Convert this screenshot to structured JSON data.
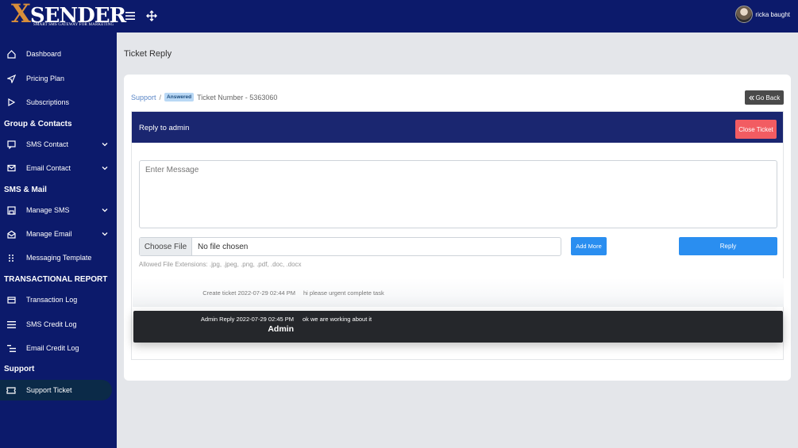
{
  "brand": {
    "logo_text": "SENDER",
    "logo_x": "X",
    "tagline": "SMART SMS GATEWAY FOR MARKETING"
  },
  "topbar": {
    "menu_icon": "hamburger-icon",
    "move_icon": "move-arrows-icon",
    "user_name": "ricka baught"
  },
  "sidebar": {
    "items": [
      {
        "label": "Dashboard",
        "icon": "home-icon"
      },
      {
        "label": "Pricing Plan",
        "icon": "send-icon"
      },
      {
        "label": "Subscriptions",
        "icon": "play-icon"
      },
      {
        "label": "SMS Contact",
        "icon": "message-icon"
      },
      {
        "label": "Email Contact",
        "icon": "mail-icon"
      },
      {
        "label": "Manage SMS",
        "icon": "save-icon"
      },
      {
        "label": "Manage Email",
        "icon": "mail-open-icon"
      },
      {
        "label": "Messaging Template",
        "icon": "grip-icon"
      },
      {
        "label": "Transaction Log",
        "icon": "card-icon"
      },
      {
        "label": "SMS Credit Log",
        "icon": "list-icon"
      },
      {
        "label": "Email Credit Log",
        "icon": "list-indent-icon"
      },
      {
        "label": "Support Ticket",
        "icon": "ticket-icon"
      }
    ],
    "headings": [
      "Group & Contacts",
      "SMS & Mail",
      "TRANSACTIONAL REPORT",
      "Support"
    ]
  },
  "page": {
    "title": "Ticket Reply"
  },
  "breadcrumb": {
    "link": "Support",
    "separator": "/",
    "badge": "Answered",
    "current": "Ticket Number - 5363060"
  },
  "buttons": {
    "go_back": "Go Back",
    "close_ticket": "Close Ticket",
    "add_more": "Add More",
    "reply": "Reply",
    "choose_file": "Choose File"
  },
  "reply_panel": {
    "title": "Reply to admin",
    "message_placeholder": "Enter Message",
    "file_status": "No file chosen",
    "allowed_extensions": "Allowed File Extensions: .jpg, .jpeg, .png, .pdf, .doc, .docx"
  },
  "thread": [
    {
      "label": "Create ticket 2022-07-29 02:44 PM",
      "author": "",
      "message": "hi please urgent complete task"
    },
    {
      "label": "Admin Reply 2022-07-29 02:45 PM",
      "author": "Admin",
      "message": "ok we are working about it"
    }
  ],
  "colors": {
    "navbar": "#0c1a6b",
    "panel_header": "#1a2670",
    "primary": "#2a8ef0",
    "danger": "#f25c62",
    "active_nav": "#0b2a48"
  }
}
